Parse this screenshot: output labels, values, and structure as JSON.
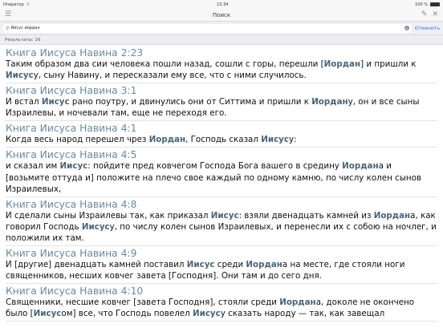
{
  "status": {
    "carrier": "Оператор",
    "time": "15:34",
    "battery": "100 %"
  },
  "navbar": {
    "title": "Поиск"
  },
  "search": {
    "query": "Иисус иордан",
    "cancel_label": "Отменить"
  },
  "results_count": "Результаты: 16",
  "results": [
    {
      "ref": "Книга Иисуса Навина 2:23",
      "parts": [
        {
          "t": "Таким образом два сии человека пошли назад, сошли с горы, перешли ["
        },
        {
          "t": "Иордан",
          "b": true
        },
        {
          "t": "] и пришли к "
        },
        {
          "t": "Иисус",
          "b": true
        },
        {
          "t": "у, сыну Навину, и пересказали ему все, что с ними случилось."
        }
      ]
    },
    {
      "ref": "Книга Иисуса Навина 3:1",
      "parts": [
        {
          "t": "И встал "
        },
        {
          "t": "Иисус",
          "b": true
        },
        {
          "t": " рано поутру, и двинулись они от Ситтима и пришли к "
        },
        {
          "t": "Иордан",
          "b": true
        },
        {
          "t": "у, он и все сыны Израилевы, и ночевали там, еще не переходя его."
        }
      ]
    },
    {
      "ref": "Книга Иисуса Навина 4:1",
      "parts": [
        {
          "t": "Когда весь народ перешел чрез "
        },
        {
          "t": "Иордан",
          "b": true
        },
        {
          "t": ", Господь сказал "
        },
        {
          "t": "Иисус",
          "b": true
        },
        {
          "t": "у:"
        }
      ]
    },
    {
      "ref": "Книга Иисуса Навина 4:5",
      "parts": [
        {
          "t": "и сказал им "
        },
        {
          "t": "Иисус",
          "b": true
        },
        {
          "t": ": пойдите пред ковчегом Господа Бога вашего в средину "
        },
        {
          "t": "Иордан",
          "b": true
        },
        {
          "t": "а и [возьмите оттуда и] положите на плечо свое каждый по одному камню, по числу колен сынов Израилевых,"
        }
      ]
    },
    {
      "ref": "Книга Иисуса Навина 4:8",
      "parts": [
        {
          "t": "И сделали сыны Израилевы так, как приказал "
        },
        {
          "t": "Иисус",
          "b": true
        },
        {
          "t": ": взяли двенадцать камней из "
        },
        {
          "t": "Иордан",
          "b": true
        },
        {
          "t": "а, как говорил Господь "
        },
        {
          "t": "Иисус",
          "b": true
        },
        {
          "t": "у, по числу колен сынов Израилевых, и перенесли их с собою на ночлег, и положили их там."
        }
      ]
    },
    {
      "ref": "Книга Иисуса Навина 4:9",
      "parts": [
        {
          "t": "И [другие] двенадцать камней поставил "
        },
        {
          "t": "Иисус",
          "b": true
        },
        {
          "t": " среди "
        },
        {
          "t": "Иордан",
          "b": true
        },
        {
          "t": "а на месте, где стояли ноги священников, несших ковчег завета [Господня]. Они там и до сего дня."
        }
      ]
    },
    {
      "ref": "Книга Иисуса Навина 4:10",
      "parts": [
        {
          "t": "Священники, несшие ковчег [завета Господня], стояли среди "
        },
        {
          "t": "Иордан",
          "b": true
        },
        {
          "t": "а, доколе не окончено было ["
        },
        {
          "t": "Иисус",
          "b": true
        },
        {
          "t": "ом] все, что Господь повелел "
        },
        {
          "t": "Иисус",
          "b": true
        },
        {
          "t": "у сказать народу — так, как завещал"
        }
      ]
    }
  ]
}
